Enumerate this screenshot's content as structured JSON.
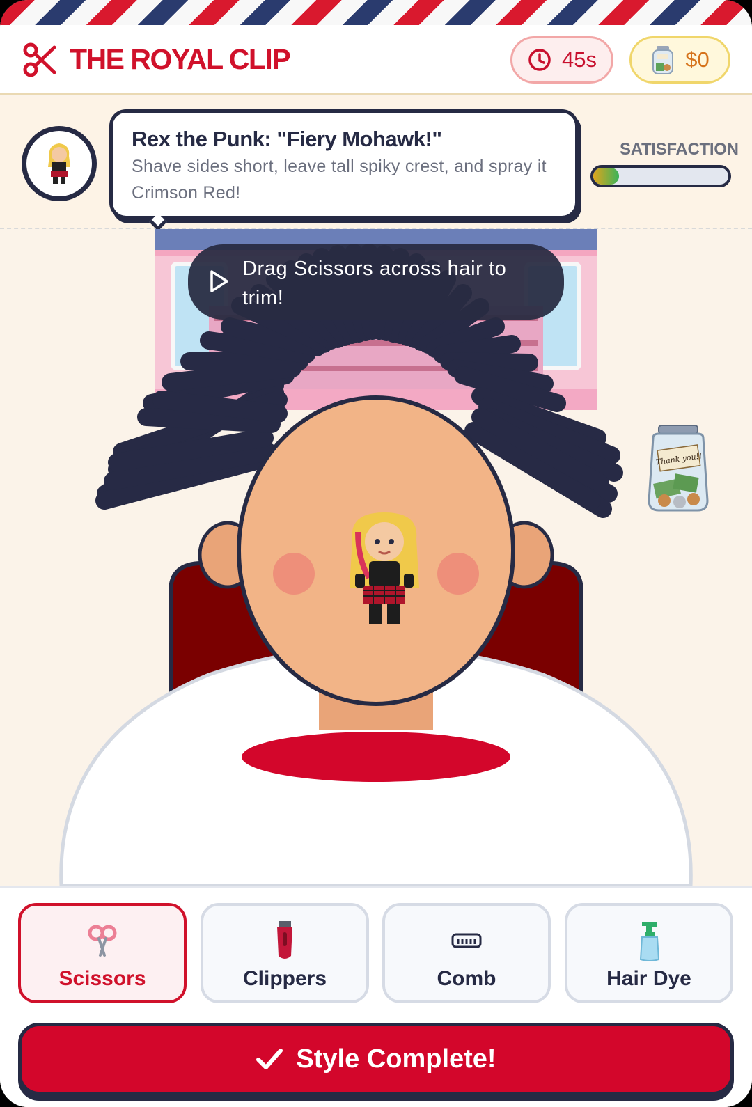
{
  "header": {
    "brand": "THE ROYAL CLIP",
    "logo_icon": "scissors-icon",
    "timer": {
      "icon": "clock-icon",
      "value": "45s"
    },
    "money": {
      "icon": "tip-jar-icon",
      "value": "$0"
    }
  },
  "order": {
    "customer_avatar": "punk-girl-avatar",
    "title": "Rex the Punk: \"Fiery Mohawk!\"",
    "description": "Shave sides short, leave tall spiky crest, and spray it Crimson Red!",
    "satisfaction_label": "SATISFACTION",
    "satisfaction_level": 0.19
  },
  "stage": {
    "tip_text": "Drag Scissors across hair to trim!",
    "tip_icon": "play-icon",
    "jar_label": "Thank you!!"
  },
  "tools": [
    {
      "label": "Scissors",
      "icon": "scissors-icon",
      "active": true
    },
    {
      "label": "Clippers",
      "icon": "clippers-icon",
      "active": false
    },
    {
      "label": "Comb",
      "icon": "comb-icon",
      "active": false
    },
    {
      "label": "Hair Dye",
      "icon": "spray-bottle-icon",
      "active": false
    }
  ],
  "complete_button": {
    "label": "Style Complete!",
    "icon": "check-icon"
  },
  "colors": {
    "brand_red": "#d0112b",
    "navy": "#262a44",
    "hair": "#272a45",
    "skin": "#f2b487",
    "cape_collar": "#d3062b",
    "chair": "#7a0000"
  }
}
